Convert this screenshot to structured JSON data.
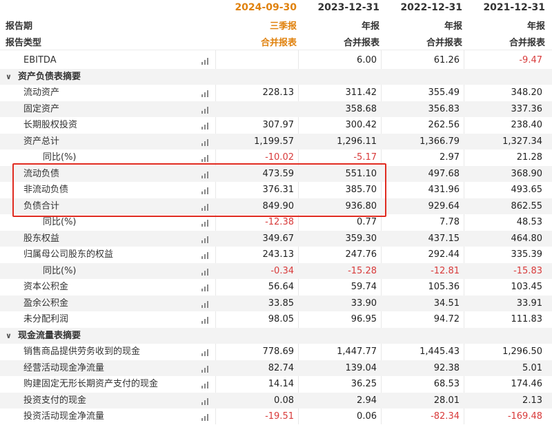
{
  "header": {
    "label_period": "报告期",
    "label_type": "报告类型",
    "columns": [
      {
        "date": "2024-09-30",
        "type": "三季报",
        "sub": "合并报表"
      },
      {
        "date": "2023-12-31",
        "type": "年报",
        "sub": "合并报表"
      },
      {
        "date": "2022-12-31",
        "type": "年报",
        "sub": "合并报表"
      },
      {
        "date": "2021-12-31",
        "type": "年报",
        "sub": "合并报表"
      }
    ]
  },
  "colors": {
    "current_column": "#e0820e",
    "negative": "#d83a3a",
    "highlight": "#e02b20",
    "stripe": "#f3f3f3"
  },
  "rows": [
    {
      "name": "EBITDA",
      "values": [
        "",
        "6.00",
        "61.26",
        "-9.47"
      ]
    },
    {
      "name": "资产负债表摘要",
      "section": true
    },
    {
      "name": "流动资产",
      "values": [
        "228.13",
        "311.42",
        "355.49",
        "348.20"
      ]
    },
    {
      "name": "固定资产",
      "values": [
        "",
        "358.68",
        "356.83",
        "337.36"
      ]
    },
    {
      "name": "长期股权投资",
      "values": [
        "307.97",
        "300.42",
        "262.56",
        "238.40"
      ]
    },
    {
      "name": "资产总计",
      "values": [
        "1,199.57",
        "1,296.11",
        "1,366.79",
        "1,327.34"
      ]
    },
    {
      "name": "同比(%)",
      "values": [
        "-10.02",
        "-5.17",
        "2.97",
        "21.28"
      ],
      "sub": true
    },
    {
      "name": "流动负债",
      "values": [
        "473.59",
        "551.10",
        "497.68",
        "368.90"
      ]
    },
    {
      "name": "非流动负债",
      "values": [
        "376.31",
        "385.70",
        "431.96",
        "493.65"
      ]
    },
    {
      "name": "负债合计",
      "values": [
        "849.90",
        "936.80",
        "929.64",
        "862.55"
      ]
    },
    {
      "name": "同比(%)",
      "values": [
        "-12.38",
        "0.77",
        "7.78",
        "48.53"
      ],
      "sub": true
    },
    {
      "name": "股东权益",
      "values": [
        "349.67",
        "359.30",
        "437.15",
        "464.80"
      ]
    },
    {
      "name": "归属母公司股东的权益",
      "values": [
        "243.13",
        "247.76",
        "292.44",
        "335.39"
      ]
    },
    {
      "name": "同比(%)",
      "values": [
        "-0.34",
        "-15.28",
        "-12.81",
        "-15.83"
      ],
      "sub": true
    },
    {
      "name": "资本公积金",
      "values": [
        "56.64",
        "59.74",
        "105.36",
        "103.45"
      ]
    },
    {
      "name": "盈余公积金",
      "values": [
        "33.85",
        "33.90",
        "34.51",
        "33.91"
      ]
    },
    {
      "name": "未分配利润",
      "values": [
        "98.05",
        "96.95",
        "94.72",
        "111.83"
      ]
    },
    {
      "name": "现金流量表摘要",
      "section": true
    },
    {
      "name": "销售商品提供劳务收到的现金",
      "values": [
        "778.69",
        "1,447.77",
        "1,445.43",
        "1,296.50"
      ]
    },
    {
      "name": "经营活动现金净流量",
      "values": [
        "82.74",
        "139.04",
        "92.38",
        "5.01"
      ]
    },
    {
      "name": "购建固定无形长期资产支付的现金",
      "values": [
        "14.14",
        "36.25",
        "68.53",
        "174.46"
      ]
    },
    {
      "name": "投资支付的现金",
      "values": [
        "0.08",
        "2.94",
        "28.01",
        "2.13"
      ]
    },
    {
      "name": "投资活动现金净流量",
      "values": [
        "-19.51",
        "0.06",
        "-82.34",
        "-169.48"
      ]
    }
  ]
}
